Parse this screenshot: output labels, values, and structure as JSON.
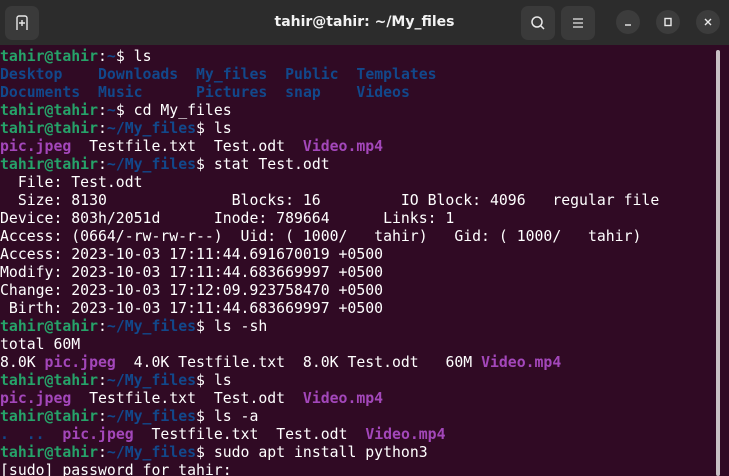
{
  "window": {
    "title": "tahir@tahir: ~/My_files",
    "new_tab_icon": "new-tab-icon",
    "search_icon": "search-icon",
    "menu_icon": "hamburger-menu-icon",
    "minimize_icon": "minimize-icon",
    "maximize_icon": "maximize-icon",
    "close_icon": "close-icon"
  },
  "colors": {
    "background": "#300a24",
    "prompt_user": "#26a269",
    "prompt_path": "#12488b",
    "directory": "#12488b",
    "media_file": "#a347ba",
    "text": "#ffffff"
  },
  "terminal": {
    "lines": [
      [
        [
          "tahir@tahir",
          "g"
        ],
        [
          ":",
          "w"
        ],
        [
          "~",
          "b"
        ],
        [
          "$ ls",
          "w"
        ]
      ],
      [
        [
          "Desktop",
          "d"
        ],
        [
          "    ",
          "w"
        ],
        [
          "Downloads",
          "d"
        ],
        [
          "  ",
          "w"
        ],
        [
          "My_files",
          "d"
        ],
        [
          "  ",
          "w"
        ],
        [
          "Public",
          "d"
        ],
        [
          "  ",
          "w"
        ],
        [
          "Templates",
          "d"
        ]
      ],
      [
        [
          "Documents",
          "d"
        ],
        [
          "  ",
          "w"
        ],
        [
          "Music",
          "d"
        ],
        [
          "      ",
          "w"
        ],
        [
          "Pictures",
          "d"
        ],
        [
          "  ",
          "w"
        ],
        [
          "snap",
          "d"
        ],
        [
          "    ",
          "w"
        ],
        [
          "Videos",
          "d"
        ]
      ],
      [
        [
          "tahir@tahir",
          "g"
        ],
        [
          ":",
          "w"
        ],
        [
          "~",
          "b"
        ],
        [
          "$ cd My_files",
          "w"
        ]
      ],
      [
        [
          "tahir@tahir",
          "g"
        ],
        [
          ":",
          "w"
        ],
        [
          "~/My_files",
          "b"
        ],
        [
          "$ ls",
          "w"
        ]
      ],
      [
        [
          "pic.jpeg",
          "p"
        ],
        [
          "  Testfile.txt  Test.odt  ",
          "w"
        ],
        [
          "Video.mp4",
          "p"
        ]
      ],
      [
        [
          "tahir@tahir",
          "g"
        ],
        [
          ":",
          "w"
        ],
        [
          "~/My_files",
          "b"
        ],
        [
          "$ stat Test.odt",
          "w"
        ]
      ],
      [
        [
          "  File: Test.odt",
          "w"
        ]
      ],
      [
        [
          "  Size: 8130      \t  Blocks: 16         IO Block: 4096   regular file",
          "w"
        ]
      ],
      [
        [
          "Device: 803h/2051d\tInode: 789664      Links: 1",
          "w"
        ]
      ],
      [
        [
          "Access: (0664/-rw-rw-r--)  Uid: ( 1000/   tahir)   Gid: ( 1000/   tahir)",
          "w"
        ]
      ],
      [
        [
          "Access: 2023-10-03 17:11:44.691670019 +0500",
          "w"
        ]
      ],
      [
        [
          "Modify: 2023-10-03 17:11:44.683669997 +0500",
          "w"
        ]
      ],
      [
        [
          "Change: 2023-10-03 17:12:09.923758470 +0500",
          "w"
        ]
      ],
      [
        [
          " Birth: 2023-10-03 17:11:44.683669997 +0500",
          "w"
        ]
      ],
      [
        [
          "tahir@tahir",
          "g"
        ],
        [
          ":",
          "w"
        ],
        [
          "~/My_files",
          "b"
        ],
        [
          "$ ls -sh",
          "w"
        ]
      ],
      [
        [
          "total 60M",
          "w"
        ]
      ],
      [
        [
          "8.0K ",
          "w"
        ],
        [
          "pic.jpeg",
          "p"
        ],
        [
          "  4.0K Testfile.txt  8.0K Test.odt   60M ",
          "w"
        ],
        [
          "Video.mp4",
          "p"
        ]
      ],
      [
        [
          "tahir@tahir",
          "g"
        ],
        [
          ":",
          "w"
        ],
        [
          "~/My_files",
          "b"
        ],
        [
          "$ ls",
          "w"
        ]
      ],
      [
        [
          "pic.jpeg",
          "p"
        ],
        [
          "  Testfile.txt  Test.odt  ",
          "w"
        ],
        [
          "Video.mp4",
          "p"
        ]
      ],
      [
        [
          "tahir@tahir",
          "g"
        ],
        [
          ":",
          "w"
        ],
        [
          "~/My_files",
          "b"
        ],
        [
          "$ ls -a",
          "w"
        ]
      ],
      [
        [
          ".",
          "d"
        ],
        [
          "  ",
          "w"
        ],
        [
          "..",
          "d"
        ],
        [
          "  ",
          "w"
        ],
        [
          "pic.jpeg",
          "p"
        ],
        [
          "  Testfile.txt  Test.odt  ",
          "w"
        ],
        [
          "Video.mp4",
          "p"
        ]
      ],
      [
        [
          "tahir@tahir",
          "g"
        ],
        [
          ":",
          "w"
        ],
        [
          "~/My_files",
          "b"
        ],
        [
          "$ sudo apt install python3",
          "w"
        ]
      ],
      [
        [
          "[sudo] password for tahir: ",
          "w"
        ]
      ]
    ]
  }
}
